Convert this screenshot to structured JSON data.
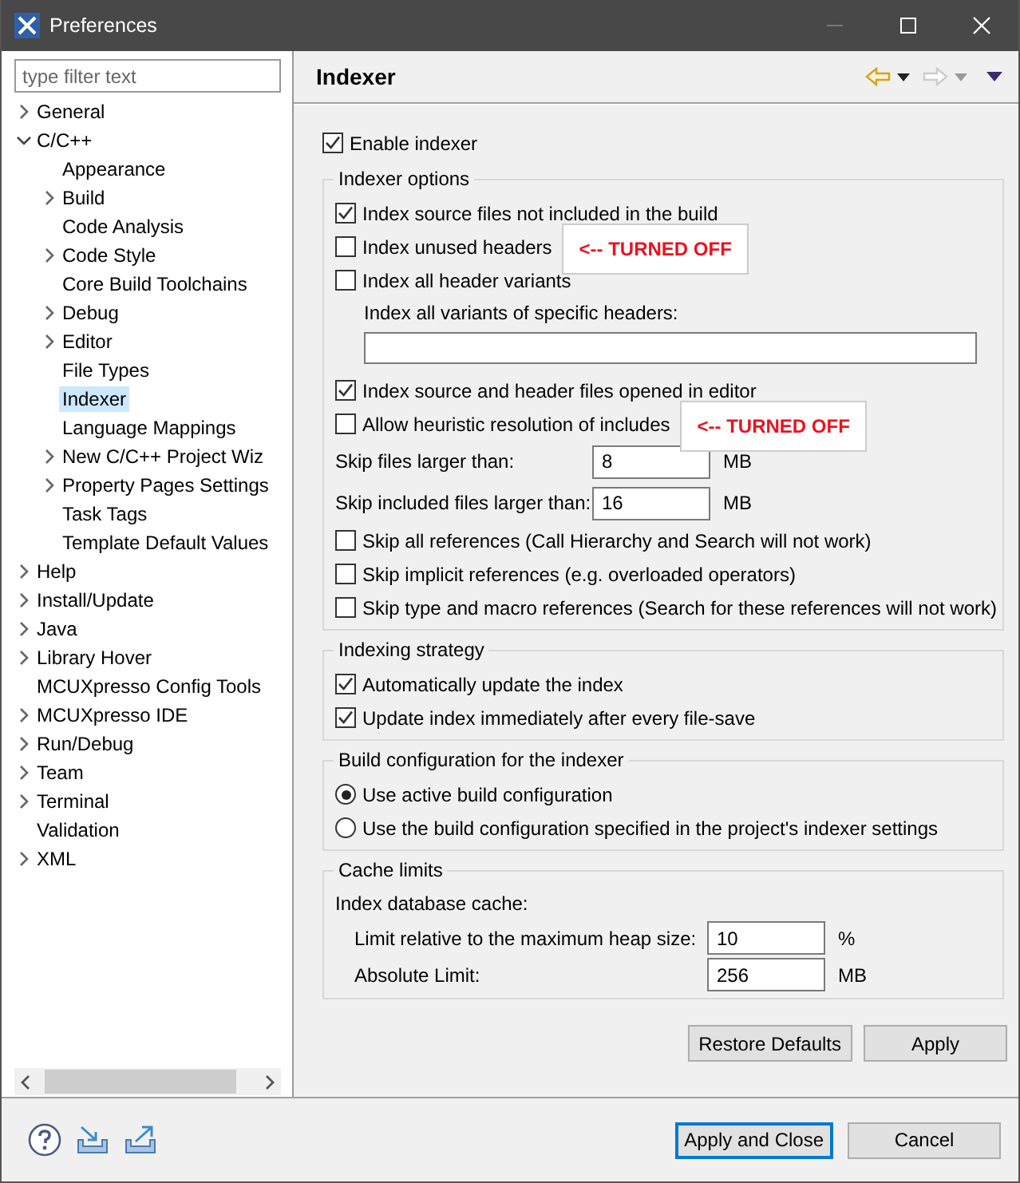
{
  "window": {
    "title": "Preferences"
  },
  "filter": {
    "placeholder": "type filter text"
  },
  "tree": [
    {
      "label": "General",
      "expandable": true,
      "expanded": false,
      "selected": false
    },
    {
      "label": "C/C++",
      "expandable": true,
      "expanded": true,
      "selected": false,
      "children": [
        {
          "label": "Appearance",
          "expandable": false,
          "selected": false
        },
        {
          "label": "Build",
          "expandable": true,
          "expanded": false,
          "selected": false
        },
        {
          "label": "Code Analysis",
          "expandable": false,
          "selected": false
        },
        {
          "label": "Code Style",
          "expandable": true,
          "expanded": false,
          "selected": false
        },
        {
          "label": "Core Build Toolchains",
          "expandable": false,
          "selected": false
        },
        {
          "label": "Debug",
          "expandable": true,
          "expanded": false,
          "selected": false
        },
        {
          "label": "Editor",
          "expandable": true,
          "expanded": false,
          "selected": false
        },
        {
          "label": "File Types",
          "expandable": false,
          "selected": false
        },
        {
          "label": "Indexer",
          "expandable": false,
          "selected": true
        },
        {
          "label": "Language Mappings",
          "expandable": false,
          "selected": false
        },
        {
          "label": "New C/C++ Project Wiz",
          "expandable": true,
          "expanded": false,
          "selected": false
        },
        {
          "label": "Property Pages Settings",
          "expandable": true,
          "expanded": false,
          "selected": false
        },
        {
          "label": "Task Tags",
          "expandable": false,
          "selected": false
        },
        {
          "label": "Template Default Values",
          "expandable": false,
          "selected": false
        }
      ]
    },
    {
      "label": "Help",
      "expandable": true,
      "expanded": false,
      "selected": false
    },
    {
      "label": "Install/Update",
      "expandable": true,
      "expanded": false,
      "selected": false
    },
    {
      "label": "Java",
      "expandable": true,
      "expanded": false,
      "selected": false
    },
    {
      "label": "Library Hover",
      "expandable": true,
      "expanded": false,
      "selected": false
    },
    {
      "label": "MCUXpresso Config Tools",
      "expandable": false,
      "selected": false
    },
    {
      "label": "MCUXpresso IDE",
      "expandable": true,
      "expanded": false,
      "selected": false
    },
    {
      "label": "Run/Debug",
      "expandable": true,
      "expanded": false,
      "selected": false
    },
    {
      "label": "Team",
      "expandable": true,
      "expanded": false,
      "selected": false
    },
    {
      "label": "Terminal",
      "expandable": true,
      "expanded": false,
      "selected": false
    },
    {
      "label": "Validation",
      "expandable": false,
      "selected": false
    },
    {
      "label": "XML",
      "expandable": true,
      "expanded": false,
      "selected": false
    }
  ],
  "page": {
    "title": "Indexer",
    "back_enabled": true,
    "forward_enabled": false
  },
  "enable": {
    "label": "Enable indexer",
    "checked": true
  },
  "groups": [
    {
      "title": "Indexer options",
      "items": [
        {
          "kind": "checkbox",
          "label": "Index source files not included in the build",
          "checked": true
        },
        {
          "kind": "checkbox",
          "label": "Index unused headers",
          "checked": false,
          "callout": "<-- TURNED OFF"
        },
        {
          "kind": "checkbox",
          "label": "Index all header variants",
          "checked": false
        },
        {
          "kind": "label",
          "label": "Index all variants of specific headers:"
        },
        {
          "kind": "field"
        },
        {
          "kind": "checkbox",
          "label": "Index source and header files opened in editor",
          "checked": true
        },
        {
          "kind": "checkbox",
          "label": "Allow heuristic resolution of includes",
          "checked": false,
          "callout": "<-- TURNED OFF"
        },
        {
          "kind": "number",
          "label": "Skip files larger than:",
          "value": "8",
          "unit": "MB"
        },
        {
          "kind": "number",
          "label": "Skip included files larger than:",
          "value": "16",
          "unit": "MB"
        },
        {
          "kind": "checkbox",
          "label": "Skip all references (Call Hierarchy and Search will not work)",
          "checked": false
        },
        {
          "kind": "checkbox",
          "label": "Skip implicit references (e.g. overloaded operators)",
          "checked": false
        },
        {
          "kind": "checkbox",
          "label": "Skip type and macro references (Search for these references will not work)",
          "checked": false
        }
      ]
    },
    {
      "title": "Indexing strategy",
      "items": [
        {
          "kind": "checkbox",
          "label": "Automatically update the index",
          "checked": true
        },
        {
          "kind": "checkbox",
          "label": "Update index immediately after every file-save",
          "checked": true
        }
      ]
    },
    {
      "title": "Build configuration for the indexer",
      "items": [
        {
          "kind": "radio",
          "label": "Use active build configuration",
          "selected": true
        },
        {
          "kind": "radio",
          "label": "Use the build configuration specified in the project's indexer settings",
          "selected": false
        }
      ]
    },
    {
      "title": "Cache limits",
      "items": [
        {
          "kind": "label",
          "label": "Index database cache:"
        },
        {
          "kind": "subnumber",
          "label": "Limit relative to the maximum heap size:",
          "value": "10",
          "unit": "%"
        },
        {
          "kind": "subnumber",
          "label": "Absolute Limit:",
          "value": "256",
          "unit": "MB"
        }
      ]
    }
  ],
  "page_buttons": [
    "Restore Defaults",
    "Apply"
  ],
  "dialog_buttons": [
    {
      "label": "Apply and Close",
      "default": true
    },
    {
      "label": "Cancel",
      "default": false
    }
  ]
}
